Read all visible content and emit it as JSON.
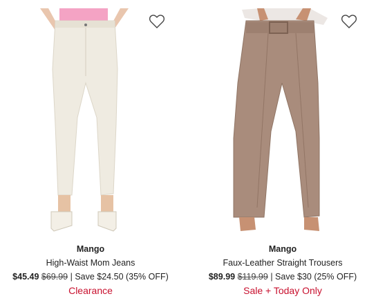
{
  "products": [
    {
      "brand": "Mango",
      "name": "High-Waist Mom Jeans",
      "price_now": "$45.49",
      "price_was": "$69.99",
      "savings": " | Save $24.50 (35% OFF)",
      "badge": "Clearance",
      "wishlist_icon": "heart-outline-icon",
      "image_desc_color": "#efebe1"
    },
    {
      "brand": "Mango",
      "name": "Faux-Leather Straight Trousers",
      "price_now": "$89.99",
      "price_was": "$119.99",
      "savings": " | Save $30 (25% OFF)",
      "badge": "Sale + Today Only",
      "wishlist_icon": "heart-outline-icon",
      "image_desc_color": "#a98c7c"
    }
  ],
  "colors": {
    "badge": "#c8102e",
    "text": "#222222"
  }
}
